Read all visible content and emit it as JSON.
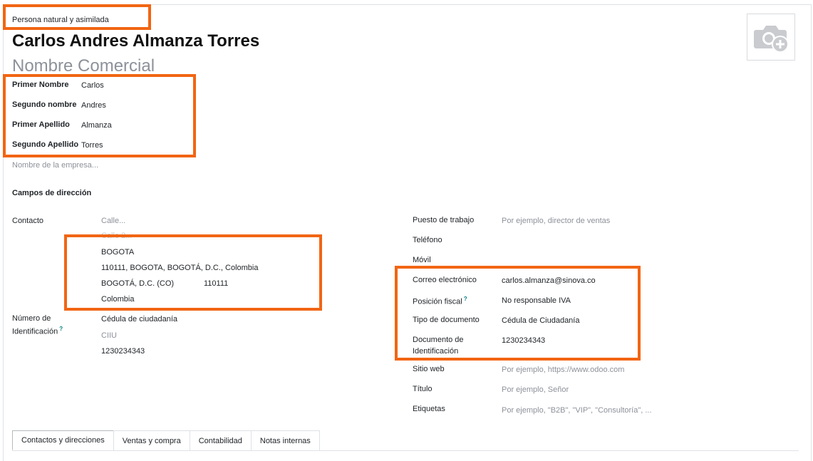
{
  "company_type": "Persona natural y asimilada",
  "partner_name": "Carlos Andres Almanza Torres",
  "trade_name_placeholder": "Nombre Comercial",
  "names": {
    "first_name_label": "Primer Nombre",
    "first_name": "Carlos",
    "second_name_label": "Segundo nombre",
    "second_name": "Andres",
    "first_lastname_label": "Primer Apellido",
    "first_lastname": "Almanza",
    "second_lastname_label": "Segundo Apellido",
    "second_lastname": "Torres"
  },
  "company_placeholder": "Nombre de la empresa...",
  "address_fields_label": "Campos de dirección",
  "contact": {
    "label": "Contacto",
    "street_placeholder": "Calle...",
    "street2_placeholder": "Calle 2...",
    "city": "BOGOTA",
    "full_location": "110111, BOGOTA, BOGOTÁ, D.C., Colombia",
    "state": "BOGOTÁ, D.C. (CO)",
    "zip": "110111",
    "country": "Colombia"
  },
  "identification": {
    "label_line1": "Número de",
    "label_line2": "Identificación",
    "tooltip": "?",
    "doc_type": "Cédula de ciudadanía",
    "ciiu_placeholder": "CIIU",
    "number": "1230234343"
  },
  "right": {
    "job_label": "Puesto de trabajo",
    "job_placeholder": "Por ejemplo, director de ventas",
    "phone_label": "Teléfono",
    "mobile_label": "Móvil",
    "email_label": "Correo electrónico",
    "email": "carlos.almanza@sinova.co",
    "fiscal_label": "Posición fiscal",
    "fiscal_tooltip": "?",
    "fiscal_value": "No responsable IVA",
    "doc_type_label": "Tipo de documento",
    "doc_type_value": "Cédula de Ciudadanía",
    "doc_id_label_line1": "Documento de",
    "doc_id_label_line2": "Identificación",
    "doc_id_value": "1230234343",
    "website_label": "Sitio web",
    "website_placeholder": "Por ejemplo, https://www.odoo.com",
    "title_label": "Título",
    "title_placeholder": "Por ejemplo, Señor",
    "tags_label": "Etiquetas",
    "tags_placeholder": "Por ejemplo, \"B2B\", \"VIP\", \"Consultoría\", ..."
  },
  "tabs": [
    {
      "label": "Contactos y direcciones"
    },
    {
      "label": "Ventas y compra"
    },
    {
      "label": "Contabilidad"
    },
    {
      "label": "Notas internas"
    }
  ],
  "avatar_icon": "camera-plus-icon",
  "colors": {
    "highlight": "#f26513",
    "placeholder": "#8d9199",
    "border": "#dee2e6"
  }
}
